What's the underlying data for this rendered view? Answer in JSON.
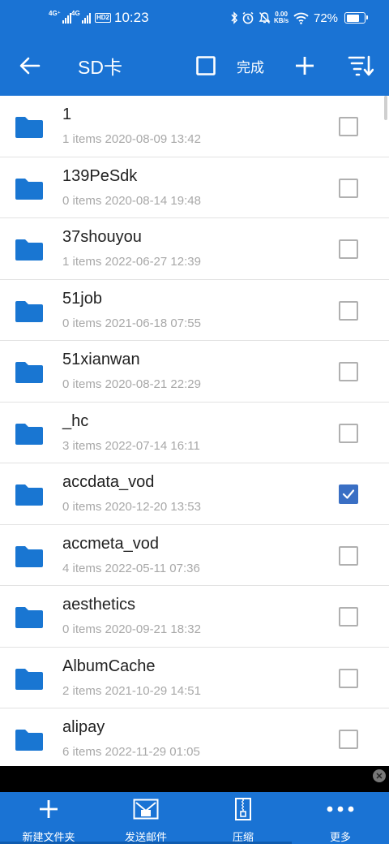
{
  "status_bar": {
    "sim1": "4G⁺",
    "sim2": "4G",
    "hd": "HD2",
    "time": "10:23",
    "speed_value": "0.00",
    "speed_unit": "KB/s",
    "battery_percent": "72%",
    "battery_level": 0.72,
    "icons": [
      "bluetooth-icon",
      "alarm-icon",
      "mute-icon",
      "wifi-icon",
      "battery-icon"
    ]
  },
  "app_bar": {
    "title": "SD卡",
    "done_label": "完成",
    "icons": [
      "back-arrow-icon",
      "select-all-icon",
      "add-icon",
      "sort-icon"
    ]
  },
  "files": [
    {
      "name": "1",
      "meta": "1 items 2020-08-09 13:42",
      "checked": false
    },
    {
      "name": "139PeSdk",
      "meta": "0 items 2020-08-14 19:48",
      "checked": false
    },
    {
      "name": "37shouyou",
      "meta": "1 items 2022-06-27 12:39",
      "checked": false
    },
    {
      "name": "51job",
      "meta": "0 items 2021-06-18 07:55",
      "checked": false
    },
    {
      "name": "51xianwan",
      "meta": "0 items 2020-08-21 22:29",
      "checked": false
    },
    {
      "name": "_hc",
      "meta": "3 items 2022-07-14 16:11",
      "checked": false
    },
    {
      "name": "accdata_vod",
      "meta": "0 items 2020-12-20 13:53",
      "checked": true
    },
    {
      "name": "accmeta_vod",
      "meta": "4 items 2022-05-11 07:36",
      "checked": false
    },
    {
      "name": "aesthetics",
      "meta": "0 items 2020-09-21 18:32",
      "checked": false
    },
    {
      "name": "AlbumCache",
      "meta": "2 items 2021-10-29 14:51",
      "checked": false
    },
    {
      "name": "alipay",
      "meta": "6 items 2022-11-29 01:05",
      "checked": false
    }
  ],
  "bottom_bar": {
    "items": [
      {
        "label": "新建文件夹",
        "icon": "plus-icon"
      },
      {
        "label": "发送邮件",
        "icon": "mail-icon"
      },
      {
        "label": "压缩",
        "icon": "zip-icon"
      },
      {
        "label": "更多",
        "icon": "more-icon"
      }
    ]
  },
  "colors": {
    "primary": "#1a73d4",
    "folder": "#1976d2",
    "checked": "#3a6fc4",
    "meta_text": "#a8a8a8"
  }
}
